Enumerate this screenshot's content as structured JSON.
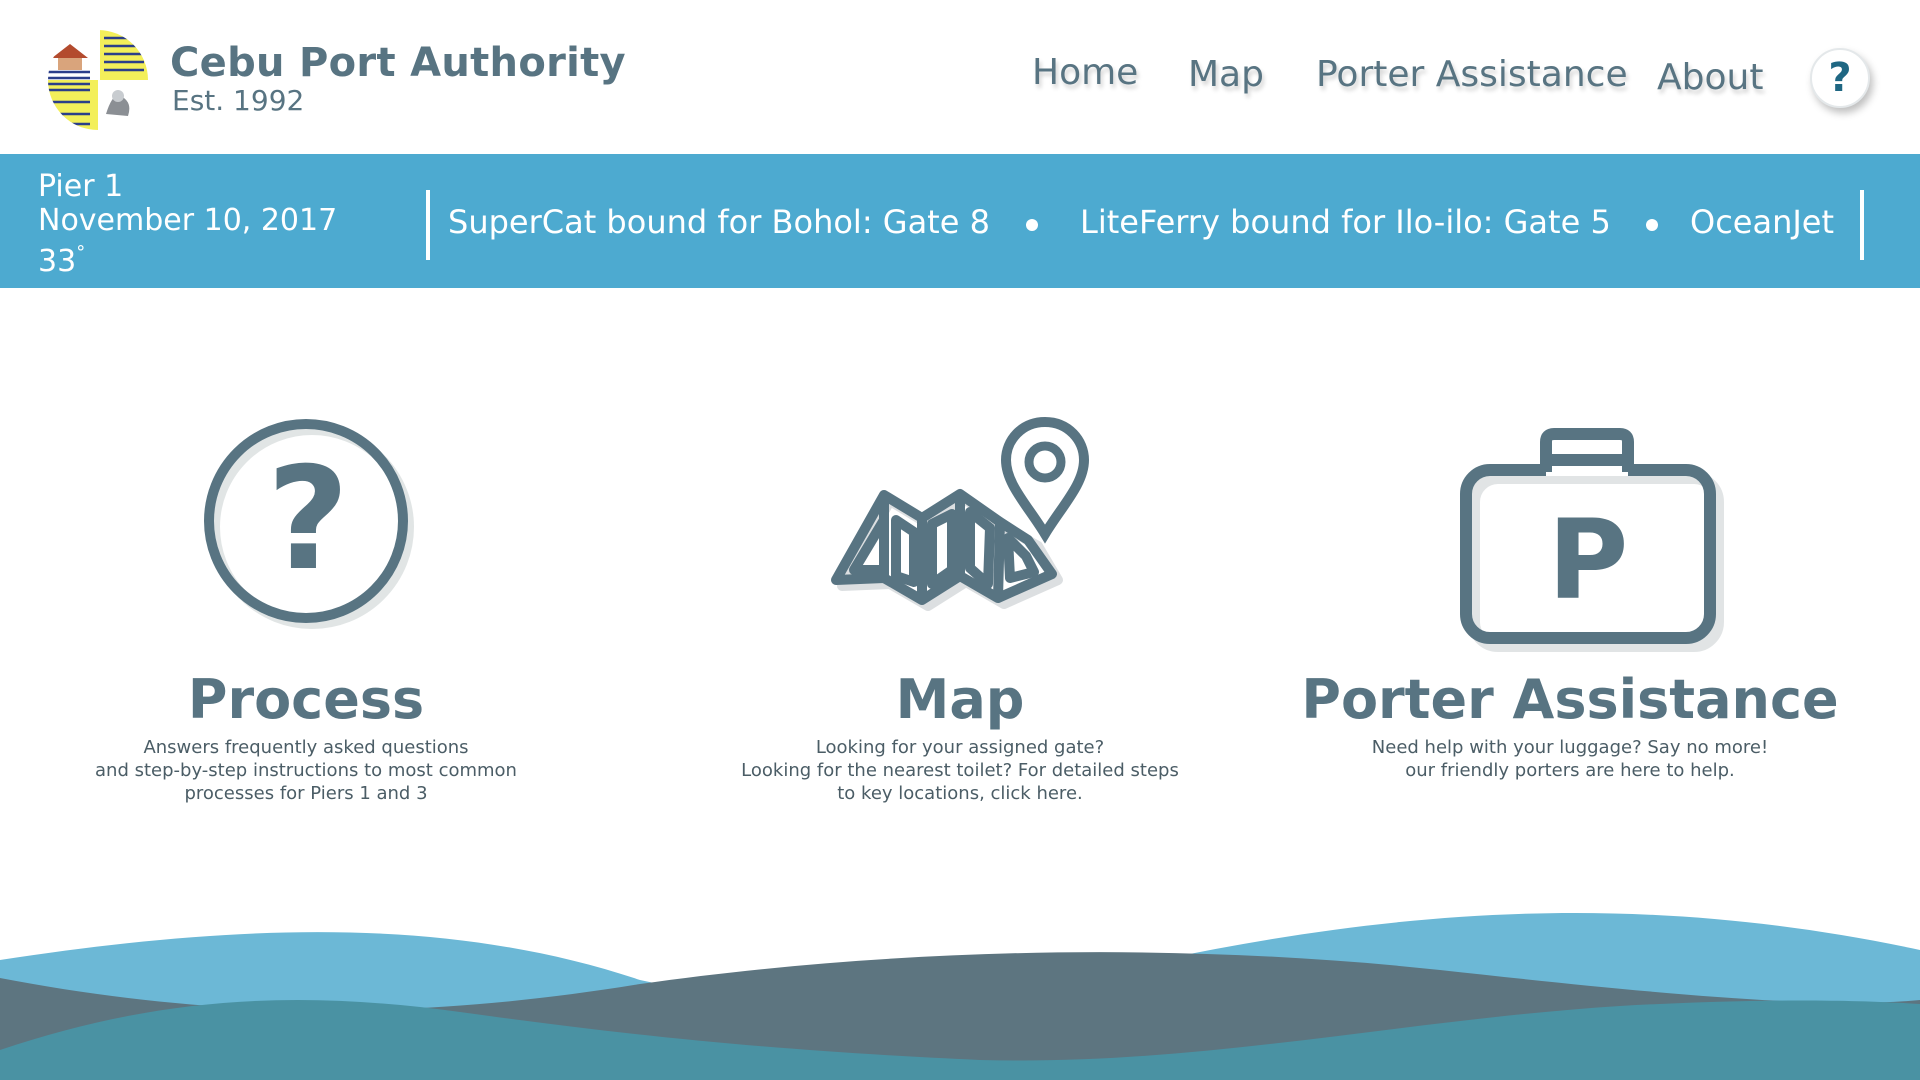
{
  "header": {
    "brand_name": "Cebu Port Authority",
    "brand_est": "Est. 1992",
    "nav": {
      "home": "Home",
      "map": "Map",
      "porter": "Porter Assistance",
      "about": "About"
    },
    "help_symbol": "?"
  },
  "infobar": {
    "pier": "Pier 1",
    "date": "November 10, 2017",
    "temperature": "33",
    "temperature_unit": "°",
    "ticker": [
      "SuperCat bound for Bohol: Gate 8",
      "LiteFerry bound for Ilo-ilo: Gate 5",
      "OceanJet"
    ]
  },
  "cards": [
    {
      "title": "Process",
      "icon": "question-circle-icon",
      "description": [
        "Answers frequently asked questions",
        "and step-by-step instructions to most common",
        "processes for Piers 1 and 3"
      ]
    },
    {
      "title": "Map",
      "icon": "map-pin-icon",
      "description": [
        "Looking for your assigned gate?",
        "Looking for the nearest toilet? For detailed steps",
        "to key locations, click here."
      ]
    },
    {
      "title": "Porter Assistance",
      "icon": "porter-luggage-icon",
      "icon_letter": "P",
      "description": [
        "Need help with your luggage? Say no more!",
        "our friendly porters are here to help."
      ]
    }
  ],
  "colors": {
    "primary_text": "#587482",
    "info_bar": "#4daad0",
    "wave_light": "#6cb8d6",
    "wave_dark": "#5d7580",
    "wave_teal": "#4a92a3",
    "accent_dark": "#1f6783"
  }
}
